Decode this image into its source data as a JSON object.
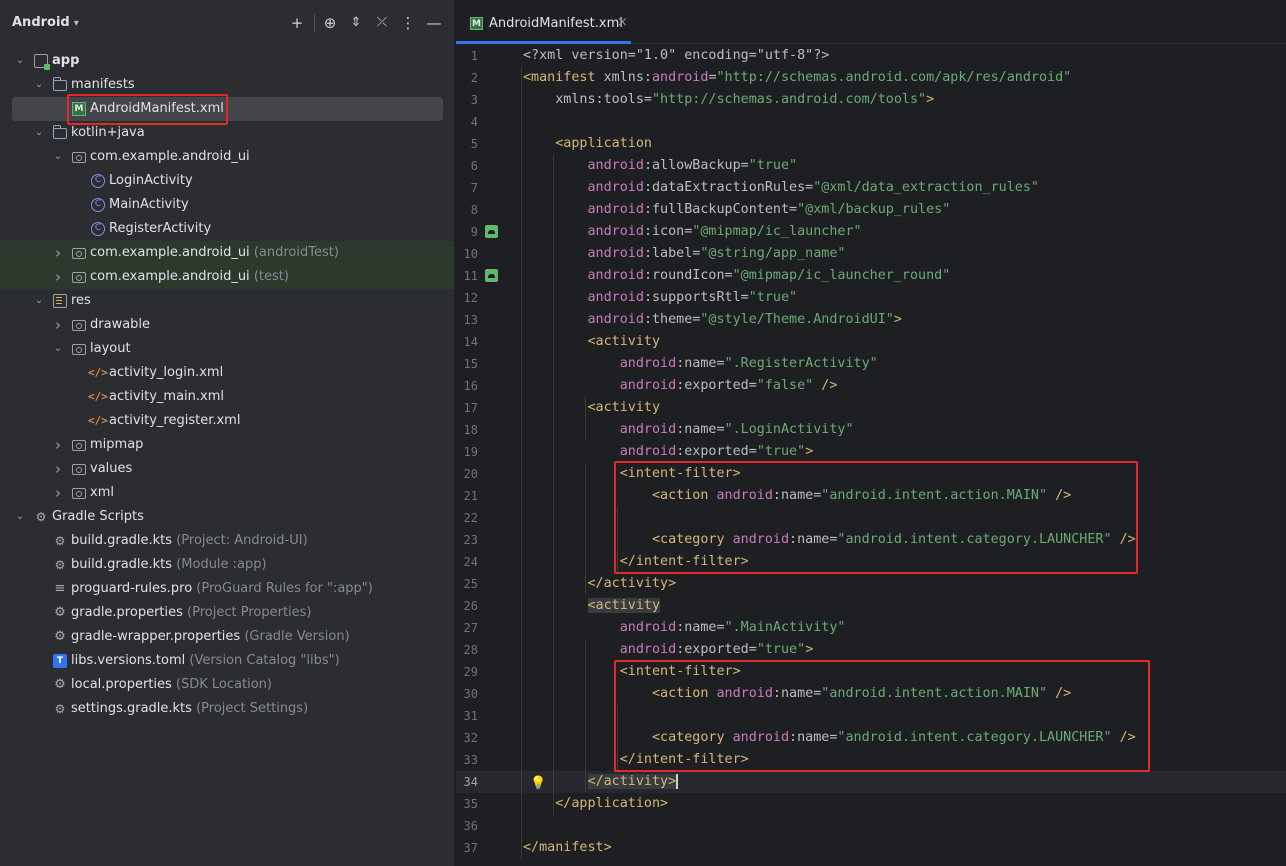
{
  "panel": {
    "title": "Android",
    "buttons": [
      {
        "name": "add-button",
        "glyph": "+"
      },
      {
        "name": "locate-button",
        "glyph": "⊕"
      },
      {
        "name": "expand-all-button",
        "glyph": "⌃"
      },
      {
        "name": "collapse-all-button",
        "glyph": "⤫"
      },
      {
        "name": "options-button",
        "glyph": "⋮"
      },
      {
        "name": "hide-button",
        "glyph": "—"
      }
    ]
  },
  "tree": [
    {
      "label": "app",
      "hint": "",
      "icon": "app",
      "arrow": "down",
      "indent": 0,
      "bold": true
    },
    {
      "label": "manifests",
      "hint": "",
      "icon": "folder",
      "arrow": "down",
      "indent": 1
    },
    {
      "label": "AndroidManifest.xml",
      "hint": "",
      "icon": "manifest",
      "arrow": "",
      "indent": 2,
      "selected": true
    },
    {
      "label": "kotlin+java",
      "hint": "",
      "icon": "folder",
      "arrow": "down",
      "indent": 1
    },
    {
      "label": "com.example.android_ui",
      "hint": "",
      "icon": "package",
      "arrow": "down",
      "indent": 2
    },
    {
      "label": "LoginActivity",
      "hint": "",
      "icon": "class",
      "arrow": "",
      "indent": 3
    },
    {
      "label": "MainActivity",
      "hint": "",
      "icon": "class",
      "arrow": "",
      "indent": 3
    },
    {
      "label": "RegisterActivity",
      "hint": "",
      "icon": "class",
      "arrow": "",
      "indent": 3
    },
    {
      "label": "com.example.android_ui",
      "hint": "(androidTest)",
      "icon": "package",
      "arrow": "right",
      "indent": 2,
      "green": true
    },
    {
      "label": "com.example.android_ui",
      "hint": "(test)",
      "icon": "package",
      "arrow": "right",
      "indent": 2,
      "green": true
    },
    {
      "label": "res",
      "hint": "",
      "icon": "res",
      "arrow": "down",
      "indent": 1
    },
    {
      "label": "drawable",
      "hint": "",
      "icon": "package",
      "arrow": "right",
      "indent": 2
    },
    {
      "label": "layout",
      "hint": "",
      "icon": "package",
      "arrow": "down",
      "indent": 2
    },
    {
      "label": "activity_login.xml",
      "hint": "",
      "icon": "xml",
      "arrow": "",
      "indent": 3
    },
    {
      "label": "activity_main.xml",
      "hint": "",
      "icon": "xml",
      "arrow": "",
      "indent": 3
    },
    {
      "label": "activity_register.xml",
      "hint": "",
      "icon": "xml",
      "arrow": "",
      "indent": 3
    },
    {
      "label": "mipmap",
      "hint": "",
      "icon": "package",
      "arrow": "right",
      "indent": 2
    },
    {
      "label": "values",
      "hint": "",
      "icon": "package",
      "arrow": "right",
      "indent": 2
    },
    {
      "label": "xml",
      "hint": "",
      "icon": "package",
      "arrow": "right",
      "indent": 2
    },
    {
      "label": "Gradle Scripts",
      "hint": "",
      "icon": "gradle",
      "arrow": "down",
      "indent": 0
    },
    {
      "label": "build.gradle.kts",
      "hint": "(Project: Android-UI)",
      "icon": "gradle",
      "arrow": "",
      "indent": 1
    },
    {
      "label": "build.gradle.kts",
      "hint": "(Module :app)",
      "icon": "gradle",
      "arrow": "",
      "indent": 1
    },
    {
      "label": "proguard-rules.pro",
      "hint": "(ProGuard Rules for \":app\")",
      "icon": "lines",
      "arrow": "",
      "indent": 1
    },
    {
      "label": "gradle.properties",
      "hint": "(Project Properties)",
      "icon": "gear",
      "arrow": "",
      "indent": 1
    },
    {
      "label": "gradle-wrapper.properties",
      "hint": "(Gradle Version)",
      "icon": "gear",
      "arrow": "",
      "indent": 1
    },
    {
      "label": "libs.versions.toml",
      "hint": "(Version Catalog \"libs\")",
      "icon": "toml",
      "arrow": "",
      "indent": 1
    },
    {
      "label": "local.properties",
      "hint": "(SDK Location)",
      "icon": "gear",
      "arrow": "",
      "indent": 1
    },
    {
      "label": "settings.gradle.kts",
      "hint": "(Project Settings)",
      "icon": "gradle",
      "arrow": "",
      "indent": 1
    }
  ],
  "editor": {
    "tab_label": "AndroidManifest.xml",
    "tab_close": "×",
    "current_line": 34,
    "lines": [
      [
        [
          "pun",
          "<?xml version=\"1.0\" encoding=\"utf-8\"?>"
        ]
      ],
      [
        [
          "t",
          "<manifest "
        ],
        [
          "attr",
          "xmlns:"
        ],
        [
          "ns",
          "android"
        ],
        [
          "attr",
          "="
        ],
        [
          "val",
          "\"http://schemas.android.com/apk/res/android\""
        ]
      ],
      [
        [
          "attr",
          "    xmlns:tools="
        ],
        [
          "val",
          "\"http://schemas.android.com/tools\""
        ],
        [
          "t",
          ">"
        ]
      ],
      [],
      [
        [
          "t",
          "    <application"
        ]
      ],
      [
        [
          "ns",
          "        android"
        ],
        [
          "attr",
          ":allowBackup="
        ],
        [
          "val",
          "\"true\""
        ]
      ],
      [
        [
          "ns",
          "        android"
        ],
        [
          "attr",
          ":dataExtractionRules="
        ],
        [
          "val",
          "\"@xml/data_extraction_rules\""
        ]
      ],
      [
        [
          "ns",
          "        android"
        ],
        [
          "attr",
          ":fullBackupContent="
        ],
        [
          "val",
          "\"@xml/backup_rules\""
        ]
      ],
      [
        [
          "ns",
          "        android"
        ],
        [
          "attr",
          ":icon="
        ],
        [
          "val",
          "\"@mipmap/ic_launcher\""
        ]
      ],
      [
        [
          "ns",
          "        android"
        ],
        [
          "attr",
          ":label="
        ],
        [
          "val",
          "\"@string/app_name\""
        ]
      ],
      [
        [
          "ns",
          "        android"
        ],
        [
          "attr",
          ":roundIcon="
        ],
        [
          "val",
          "\"@mipmap/ic_launcher_round\""
        ]
      ],
      [
        [
          "ns",
          "        android"
        ],
        [
          "attr",
          ":supportsRtl="
        ],
        [
          "val",
          "\"true\""
        ]
      ],
      [
        [
          "ns",
          "        android"
        ],
        [
          "attr",
          ":theme="
        ],
        [
          "val",
          "\"@style/Theme.AndroidUI\""
        ],
        [
          "t",
          ">"
        ]
      ],
      [
        [
          "t",
          "        <activity"
        ]
      ],
      [
        [
          "ns",
          "            android"
        ],
        [
          "attr",
          ":name="
        ],
        [
          "val",
          "\".RegisterActivity\""
        ]
      ],
      [
        [
          "ns",
          "            android"
        ],
        [
          "attr",
          ":exported="
        ],
        [
          "val",
          "\"false\""
        ],
        [
          "t",
          " />"
        ]
      ],
      [
        [
          "t",
          "        <activity"
        ]
      ],
      [
        [
          "ns",
          "            android"
        ],
        [
          "attr",
          ":name="
        ],
        [
          "val",
          "\".LoginActivity\""
        ]
      ],
      [
        [
          "ns",
          "            android"
        ],
        [
          "attr",
          ":exported="
        ],
        [
          "val",
          "\"true\""
        ],
        [
          "t",
          ">"
        ]
      ],
      [
        [
          "t",
          "            <intent-filter>"
        ]
      ],
      [
        [
          "t",
          "                <action "
        ],
        [
          "ns",
          "android"
        ],
        [
          "attr",
          ":name="
        ],
        [
          "val",
          "\"android.intent.action.MAIN\""
        ],
        [
          "t",
          " />"
        ]
      ],
      [],
      [
        [
          "t",
          "                <category "
        ],
        [
          "ns",
          "android"
        ],
        [
          "attr",
          ":name="
        ],
        [
          "val",
          "\"android.intent.category.LAUNCHER\""
        ],
        [
          "t",
          " />"
        ]
      ],
      [
        [
          "t",
          "            </intent-filter>"
        ]
      ],
      [
        [
          "t",
          "        </activity>"
        ]
      ],
      [
        [
          "t",
          "        "
        ],
        [
          "t hl",
          "<activity"
        ]
      ],
      [
        [
          "ns",
          "            android"
        ],
        [
          "attr",
          ":name="
        ],
        [
          "val",
          "\".MainActivity\""
        ]
      ],
      [
        [
          "ns",
          "            android"
        ],
        [
          "attr",
          ":exported="
        ],
        [
          "val",
          "\"true\""
        ],
        [
          "t",
          ">"
        ]
      ],
      [
        [
          "t",
          "            <intent-filter>"
        ]
      ],
      [
        [
          "t",
          "                <action "
        ],
        [
          "ns",
          "android"
        ],
        [
          "attr",
          ":name="
        ],
        [
          "val",
          "\"android.intent.action.MAIN\""
        ],
        [
          "t",
          " />"
        ]
      ],
      [],
      [
        [
          "t",
          "                <category "
        ],
        [
          "ns",
          "android"
        ],
        [
          "attr",
          ":name="
        ],
        [
          "val",
          "\"android.intent.category.LAUNCHER\""
        ],
        [
          "t",
          " />"
        ]
      ],
      [
        [
          "t",
          "            </intent-filter>"
        ]
      ],
      [
        [
          "t",
          "        "
        ],
        [
          "t hl caret",
          "</activity>"
        ]
      ],
      [
        [
          "t",
          "    </application>"
        ]
      ],
      [],
      [
        [
          "t",
          "</manifest>"
        ]
      ]
    ],
    "gutter_icons": [
      9,
      11
    ],
    "bulb_line": 34
  }
}
